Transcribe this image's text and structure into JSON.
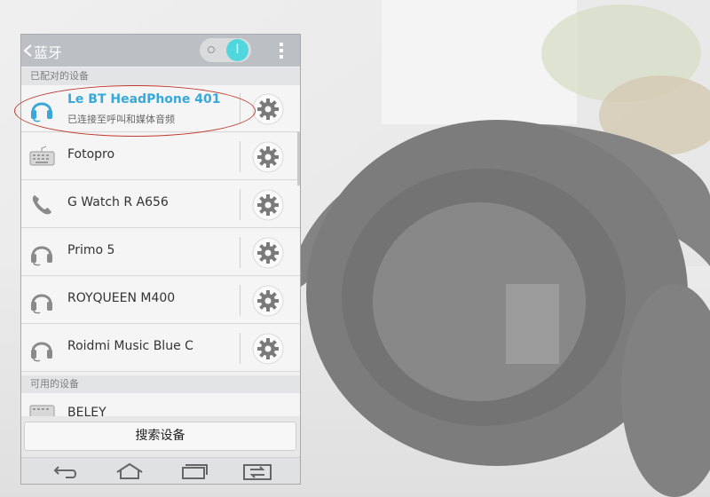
{
  "header": {
    "back_icon": "chevron-left-icon",
    "title": "蓝牙",
    "bluetooth_toggle": {
      "state": "on",
      "on_label": "I"
    },
    "menu_icon": "overflow-menu-icon"
  },
  "sections": {
    "paired": "已配对的设备",
    "available": "可用的设备"
  },
  "paired_devices": [
    {
      "name": "Le BT HeadPhone 401",
      "status": "已连接至呼叫和媒体音频",
      "icon": "headset-icon",
      "connected": true
    },
    {
      "name": "Fotopro",
      "icon": "keyboard-icon"
    },
    {
      "name": "G Watch R A656",
      "icon": "phone-icon"
    },
    {
      "name": "Primo 5",
      "icon": "headset-icon"
    },
    {
      "name": "ROYQUEEN M400",
      "icon": "headset-icon"
    },
    {
      "name": "Roidmi Music Blue C",
      "icon": "headset-icon"
    }
  ],
  "available_devices": [
    {
      "name": "BELEY",
      "icon": "keyboard-icon"
    }
  ],
  "search_button": "搜索设备",
  "navbar": [
    "back-icon",
    "home-icon",
    "recent-apps-icon",
    "dual-window-icon"
  ],
  "colors": {
    "accent": "#39a8d9",
    "toggle_on": "#4fd7dd",
    "highlight": "#c0392b",
    "action_bar": "#bcc0c4"
  }
}
